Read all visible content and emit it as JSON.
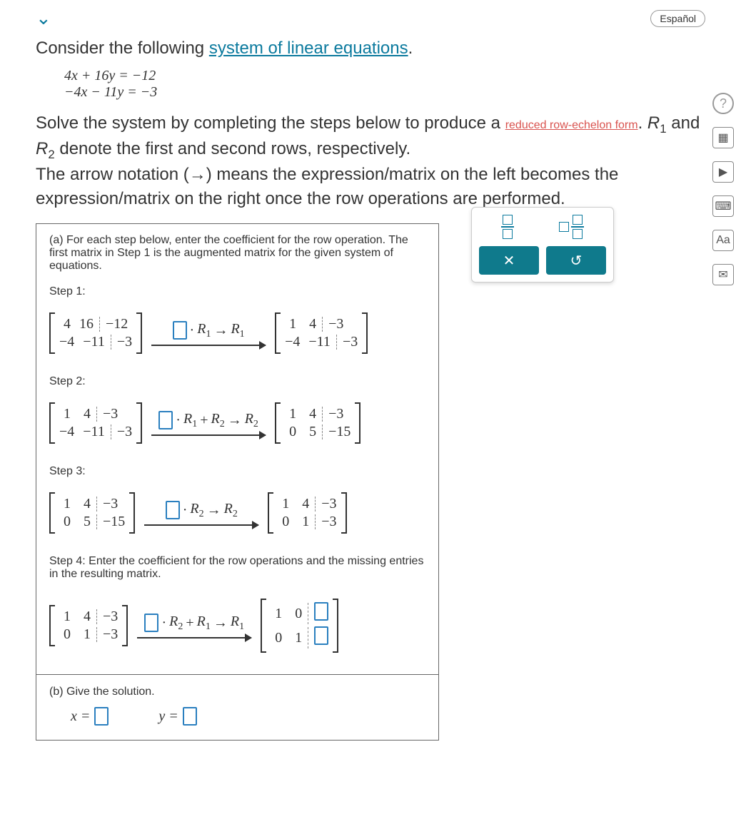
{
  "lang_label": "Español",
  "intro": {
    "prefix": "Consider the following ",
    "link": "system of linear equations",
    "suffix": "."
  },
  "equations": {
    "line1": "4x + 16y = −12",
    "line2": "−4x − 11y = −3"
  },
  "solve_text": {
    "part1": "Solve the system by completing the steps below to produce a ",
    "rref_link": "reduced row-echelon form",
    "part2": ". ",
    "part3": " and ",
    "part4": " denote the first and second rows, respectively.",
    "part5": "The arrow notation (→) means the expression/matrix on the left becomes the expression/matrix on the right once the row operations are performed."
  },
  "R1": "R₁",
  "R2": "R₂",
  "part_a": "(a) For each step below, enter the coefficient for the row operation. The first matrix in Step 1 is the augmented matrix for the given system of equations.",
  "steps": {
    "s1_label": "Step 1:",
    "s2_label": "Step 2:",
    "s3_label": "Step 3:",
    "s4_label": "Step 4: Enter the coefficient for the row operations and the missing entries in the resulting matrix."
  },
  "matrices": {
    "m1a": [
      [
        "4",
        "16",
        "−12"
      ],
      [
        "−4",
        "−11",
        "−3"
      ]
    ],
    "m1b": [
      [
        "1",
        "4",
        "−3"
      ],
      [
        "−4",
        "−11",
        "−3"
      ]
    ],
    "m2a": [
      [
        "1",
        "4",
        "−3"
      ],
      [
        "−4",
        "−11",
        "−3"
      ]
    ],
    "m2b": [
      [
        "1",
        "4",
        "−3"
      ],
      [
        "0",
        "5",
        "−15"
      ]
    ],
    "m3a": [
      [
        "1",
        "4",
        "−3"
      ],
      [
        "0",
        "5",
        "−15"
      ]
    ],
    "m3b": [
      [
        "1",
        "4",
        "−3"
      ],
      [
        "0",
        "1",
        "−3"
      ]
    ],
    "m4a": [
      [
        "1",
        "4",
        "−3"
      ],
      [
        "0",
        "1",
        "−3"
      ]
    ],
    "m4b": [
      [
        "1",
        "0",
        ""
      ],
      [
        "0",
        "1",
        ""
      ]
    ]
  },
  "ops": {
    "op1": {
      "dot": "·",
      "r": "R",
      "sub1": "1",
      "arrow": "→",
      "res": "R",
      "sub2": "1"
    },
    "op2": {
      "dot": "·",
      "r1": "R",
      "s1": "1",
      "plus": "+",
      "r2": "R",
      "s2": "2",
      "arrow": "→",
      "res": "R",
      "sres": "2"
    },
    "op3": {
      "dot": "·",
      "r": "R",
      "sub1": "2",
      "arrow": "→",
      "res": "R",
      "sub2": "2"
    },
    "op4": {
      "dot": "·",
      "r1": "R",
      "s1": "2",
      "plus": "+",
      "r2": "R",
      "s2": "1",
      "arrow": "→",
      "res": "R",
      "sres": "1"
    }
  },
  "part_b": "(b) Give the solution.",
  "solution": {
    "x_label": "x =",
    "y_label": "y ="
  },
  "toolbox": {
    "clear": "✕",
    "reset": "↺"
  },
  "rail": {
    "help": "?",
    "calc": "▦",
    "play": "▶",
    "keyboard": "⌨",
    "text": "Aa",
    "mail": "✉"
  }
}
